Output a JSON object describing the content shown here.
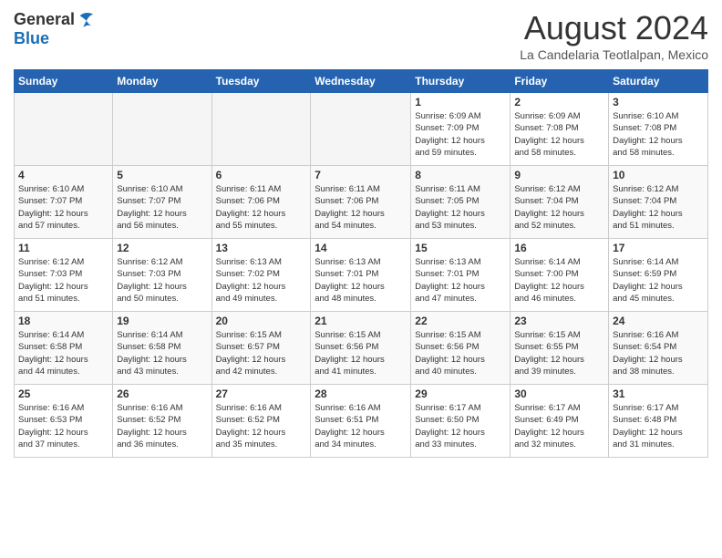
{
  "logo": {
    "general": "General",
    "blue": "Blue"
  },
  "title": "August 2024",
  "subtitle": "La Candelaria Teotlalpan, Mexico",
  "days_of_week": [
    "Sunday",
    "Monday",
    "Tuesday",
    "Wednesday",
    "Thursday",
    "Friday",
    "Saturday"
  ],
  "weeks": [
    [
      {
        "day": "",
        "info": ""
      },
      {
        "day": "",
        "info": ""
      },
      {
        "day": "",
        "info": ""
      },
      {
        "day": "",
        "info": ""
      },
      {
        "day": "1",
        "info": "Sunrise: 6:09 AM\nSunset: 7:09 PM\nDaylight: 12 hours\nand 59 minutes."
      },
      {
        "day": "2",
        "info": "Sunrise: 6:09 AM\nSunset: 7:08 PM\nDaylight: 12 hours\nand 58 minutes."
      },
      {
        "day": "3",
        "info": "Sunrise: 6:10 AM\nSunset: 7:08 PM\nDaylight: 12 hours\nand 58 minutes."
      }
    ],
    [
      {
        "day": "4",
        "info": "Sunrise: 6:10 AM\nSunset: 7:07 PM\nDaylight: 12 hours\nand 57 minutes."
      },
      {
        "day": "5",
        "info": "Sunrise: 6:10 AM\nSunset: 7:07 PM\nDaylight: 12 hours\nand 56 minutes."
      },
      {
        "day": "6",
        "info": "Sunrise: 6:11 AM\nSunset: 7:06 PM\nDaylight: 12 hours\nand 55 minutes."
      },
      {
        "day": "7",
        "info": "Sunrise: 6:11 AM\nSunset: 7:06 PM\nDaylight: 12 hours\nand 54 minutes."
      },
      {
        "day": "8",
        "info": "Sunrise: 6:11 AM\nSunset: 7:05 PM\nDaylight: 12 hours\nand 53 minutes."
      },
      {
        "day": "9",
        "info": "Sunrise: 6:12 AM\nSunset: 7:04 PM\nDaylight: 12 hours\nand 52 minutes."
      },
      {
        "day": "10",
        "info": "Sunrise: 6:12 AM\nSunset: 7:04 PM\nDaylight: 12 hours\nand 51 minutes."
      }
    ],
    [
      {
        "day": "11",
        "info": "Sunrise: 6:12 AM\nSunset: 7:03 PM\nDaylight: 12 hours\nand 51 minutes."
      },
      {
        "day": "12",
        "info": "Sunrise: 6:12 AM\nSunset: 7:03 PM\nDaylight: 12 hours\nand 50 minutes."
      },
      {
        "day": "13",
        "info": "Sunrise: 6:13 AM\nSunset: 7:02 PM\nDaylight: 12 hours\nand 49 minutes."
      },
      {
        "day": "14",
        "info": "Sunrise: 6:13 AM\nSunset: 7:01 PM\nDaylight: 12 hours\nand 48 minutes."
      },
      {
        "day": "15",
        "info": "Sunrise: 6:13 AM\nSunset: 7:01 PM\nDaylight: 12 hours\nand 47 minutes."
      },
      {
        "day": "16",
        "info": "Sunrise: 6:14 AM\nSunset: 7:00 PM\nDaylight: 12 hours\nand 46 minutes."
      },
      {
        "day": "17",
        "info": "Sunrise: 6:14 AM\nSunset: 6:59 PM\nDaylight: 12 hours\nand 45 minutes."
      }
    ],
    [
      {
        "day": "18",
        "info": "Sunrise: 6:14 AM\nSunset: 6:58 PM\nDaylight: 12 hours\nand 44 minutes."
      },
      {
        "day": "19",
        "info": "Sunrise: 6:14 AM\nSunset: 6:58 PM\nDaylight: 12 hours\nand 43 minutes."
      },
      {
        "day": "20",
        "info": "Sunrise: 6:15 AM\nSunset: 6:57 PM\nDaylight: 12 hours\nand 42 minutes."
      },
      {
        "day": "21",
        "info": "Sunrise: 6:15 AM\nSunset: 6:56 PM\nDaylight: 12 hours\nand 41 minutes."
      },
      {
        "day": "22",
        "info": "Sunrise: 6:15 AM\nSunset: 6:56 PM\nDaylight: 12 hours\nand 40 minutes."
      },
      {
        "day": "23",
        "info": "Sunrise: 6:15 AM\nSunset: 6:55 PM\nDaylight: 12 hours\nand 39 minutes."
      },
      {
        "day": "24",
        "info": "Sunrise: 6:16 AM\nSunset: 6:54 PM\nDaylight: 12 hours\nand 38 minutes."
      }
    ],
    [
      {
        "day": "25",
        "info": "Sunrise: 6:16 AM\nSunset: 6:53 PM\nDaylight: 12 hours\nand 37 minutes."
      },
      {
        "day": "26",
        "info": "Sunrise: 6:16 AM\nSunset: 6:52 PM\nDaylight: 12 hours\nand 36 minutes."
      },
      {
        "day": "27",
        "info": "Sunrise: 6:16 AM\nSunset: 6:52 PM\nDaylight: 12 hours\nand 35 minutes."
      },
      {
        "day": "28",
        "info": "Sunrise: 6:16 AM\nSunset: 6:51 PM\nDaylight: 12 hours\nand 34 minutes."
      },
      {
        "day": "29",
        "info": "Sunrise: 6:17 AM\nSunset: 6:50 PM\nDaylight: 12 hours\nand 33 minutes."
      },
      {
        "day": "30",
        "info": "Sunrise: 6:17 AM\nSunset: 6:49 PM\nDaylight: 12 hours\nand 32 minutes."
      },
      {
        "day": "31",
        "info": "Sunrise: 6:17 AM\nSunset: 6:48 PM\nDaylight: 12 hours\nand 31 minutes."
      }
    ]
  ]
}
